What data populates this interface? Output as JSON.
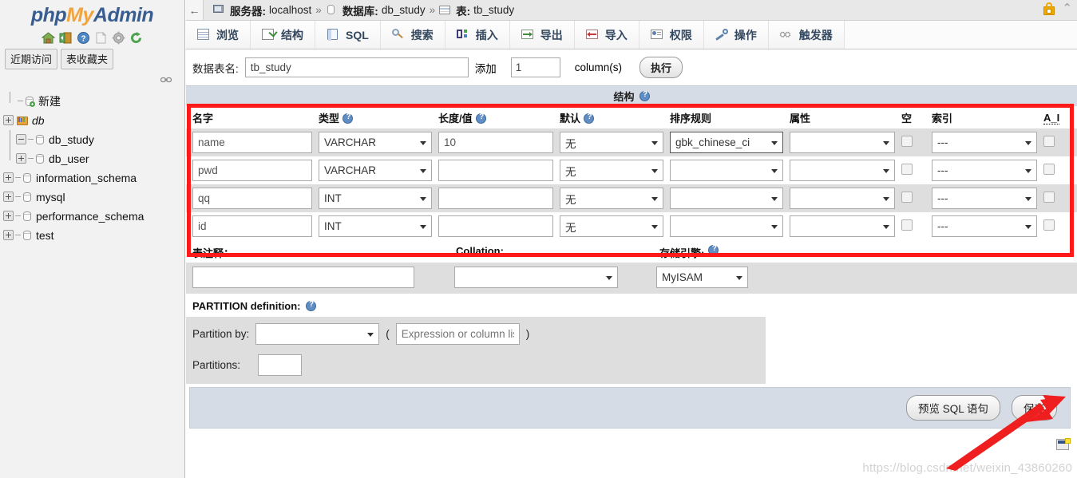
{
  "brand": {
    "php": "php",
    "my": "My",
    "admin": "Admin"
  },
  "sidebar": {
    "icons": [
      {
        "name": "home-icon",
        "label": "Home"
      },
      {
        "name": "logout-icon",
        "label": "Log out"
      },
      {
        "name": "help-icon",
        "label": "Documentation"
      },
      {
        "name": "docs-icon",
        "label": "Docs"
      },
      {
        "name": "settings-icon",
        "label": "Settings"
      },
      {
        "name": "reload-icon",
        "label": "Reload"
      }
    ],
    "tabs": [
      {
        "label": "近期访问"
      },
      {
        "label": "表收藏夹"
      }
    ],
    "tree": [
      {
        "label": "新建",
        "toggle": "none",
        "icon": "new-db-icon",
        "indent": 1,
        "italic": false
      },
      {
        "label": "db",
        "toggle": "plus",
        "icon": "db-group-icon",
        "indent": 0,
        "italic": true
      },
      {
        "label": "db_study",
        "toggle": "minus",
        "icon": "db-icon",
        "indent": 1,
        "italic": false
      },
      {
        "label": "db_user",
        "toggle": "plus",
        "icon": "db-icon",
        "indent": 1,
        "italic": false
      },
      {
        "label": "information_schema",
        "toggle": "plus",
        "icon": "db-icon",
        "indent": 0,
        "italic": false
      },
      {
        "label": "mysql",
        "toggle": "plus",
        "icon": "db-icon",
        "indent": 0,
        "italic": false
      },
      {
        "label": "performance_schema",
        "toggle": "plus",
        "icon": "db-icon",
        "indent": 0,
        "italic": false
      },
      {
        "label": "test",
        "toggle": "plus",
        "icon": "db-icon",
        "indent": 0,
        "italic": false
      }
    ]
  },
  "breadcrumb": {
    "back": "←",
    "server_label": "服务器:",
    "server_value": "localhost",
    "sep": "»",
    "db_label": "数据库:",
    "db_value": "db_study",
    "table_label": "表:",
    "table_value": "tb_study"
  },
  "tabs": [
    {
      "label": "浏览",
      "icon": "browse-icon"
    },
    {
      "label": "结构",
      "icon": "structure-icon"
    },
    {
      "label": "SQL",
      "icon": "sql-icon"
    },
    {
      "label": "搜索",
      "icon": "search-icon"
    },
    {
      "label": "插入",
      "icon": "insert-icon"
    },
    {
      "label": "导出",
      "icon": "export-icon"
    },
    {
      "label": "导入",
      "icon": "import-icon"
    },
    {
      "label": "权限",
      "icon": "privileges-icon"
    },
    {
      "label": "操作",
      "icon": "operations-icon"
    },
    {
      "label": "触发器",
      "icon": "triggers-icon"
    }
  ],
  "form": {
    "tablename_label": "数据表名:",
    "tablename_value": "tb_study",
    "add_label": "添加",
    "add_count": "1",
    "columns_label": "column(s)",
    "go_label": "执行"
  },
  "structure_header": "结构",
  "table_headers": {
    "name": "名字",
    "type": "类型",
    "length": "长度/值",
    "default": "默认",
    "collation": "排序规则",
    "attributes": "属性",
    "null": "空",
    "index": "索引",
    "ai": "A_I"
  },
  "columns": [
    {
      "name": "name",
      "type": "VARCHAR",
      "length": "10",
      "default": "无",
      "collation": "gbk_chinese_ci",
      "attributes": "",
      "null": false,
      "index": "---",
      "ai": false
    },
    {
      "name": "pwd",
      "type": "VARCHAR",
      "length": "",
      "default": "无",
      "collation": "",
      "attributes": "",
      "null": false,
      "index": "---",
      "ai": false
    },
    {
      "name": "qq",
      "type": "INT",
      "length": "",
      "default": "无",
      "collation": "",
      "attributes": "",
      "null": false,
      "index": "---",
      "ai": false
    },
    {
      "name": "id",
      "type": "INT",
      "length": "",
      "default": "无",
      "collation": "",
      "attributes": "",
      "null": false,
      "index": "---",
      "ai": false
    }
  ],
  "options": {
    "comment_label": "表注释：",
    "comment_value": "",
    "collation_label": "Collation:",
    "collation_value": "",
    "engine_label": "存储引擎:",
    "engine_value": "MyISAM"
  },
  "partition": {
    "title": "PARTITION definition:",
    "partition_by_label": "Partition by:",
    "partition_by_value": "",
    "paren_open": "(",
    "expression_placeholder": "Expression or column list",
    "paren_close": ")",
    "partitions_label": "Partitions:",
    "partitions_value": ""
  },
  "actions": {
    "preview_sql": "预览 SQL 语句",
    "save": "保存"
  },
  "watermark": "https://blog.csdn.net/weixin_43860260",
  "colors": {
    "highlight_red": "#ff1a1a",
    "brand_blue": "#3a5d8f",
    "brand_orange": "#f2a33c",
    "header_band": "#d6dce6",
    "row_alt": "#dedede"
  }
}
